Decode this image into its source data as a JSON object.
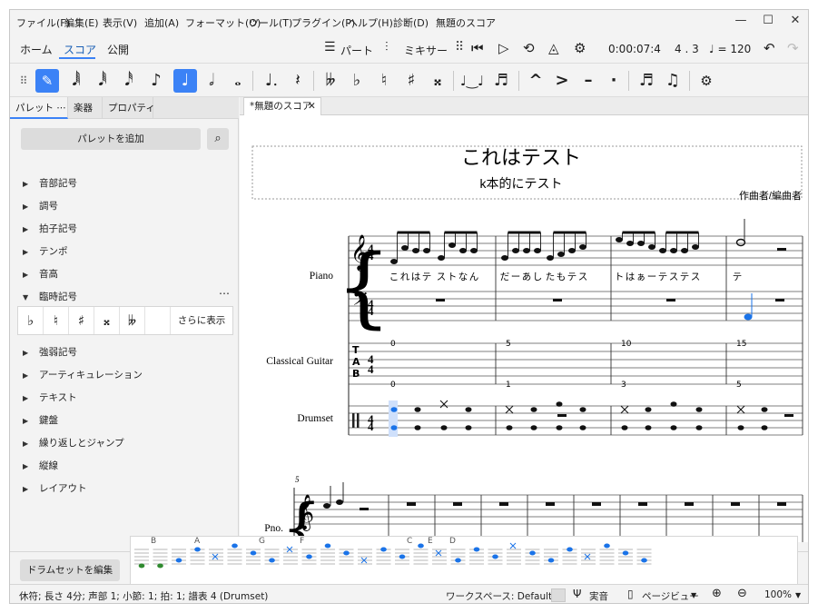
{
  "menu": {
    "items": [
      "ファイル(F)",
      "編集(E)",
      "表示(V)",
      "追加(A)",
      "フォーマット(O)",
      "ツール(T)",
      "プラグイン(P)",
      "ヘルプ(H)",
      "診断(D)",
      "無題のスコア"
    ]
  },
  "modes": {
    "home": "ホーム",
    "score": "スコア",
    "publish": "公開"
  },
  "toolbar": {
    "parts": "パート",
    "mixer": "ミキサー",
    "time": "0:00:07:4",
    "position": "4 . 3",
    "tempo": "♩ = 120"
  },
  "note_input": {
    "glyphs": [
      "✎",
      "𝅘𝅥𝅲",
      "𝅘𝅥𝅱",
      "𝅘𝅥𝅰",
      "♪",
      "♩",
      "𝅗𝅥",
      "𝅝",
      "♩.",
      "𝄽",
      "𝄫",
      "♭",
      "♮",
      "♯",
      "𝄪",
      "♩‿♩",
      "♬",
      "^",
      ">",
      "–",
      "·",
      "♬",
      "♫",
      "⚙"
    ]
  },
  "palette_tabs": [
    "パレット",
    "楽器",
    "プロパティ"
  ],
  "palette": {
    "add_button": "パレットを追加",
    "items": [
      "音部記号",
      "調号",
      "拍子記号",
      "テンポ",
      "音高",
      "臨時記号",
      "強弱記号",
      "アーティキュレーション",
      "テキスト",
      "鍵盤",
      "繰り返しとジャンプ",
      "縦線",
      "レイアウト"
    ],
    "accidentals": [
      "♭",
      "♮",
      "♯",
      "𝄪",
      "𝄫"
    ],
    "show_more": "さらに表示"
  },
  "document": {
    "tab_label": "*無題のスコア",
    "title": "これはテスト",
    "subtitle": "k本的にテスト",
    "composer": "作曲者/編曲者"
  },
  "score": {
    "instruments": [
      "Piano",
      "Classical Guitar",
      "Drumset"
    ],
    "lyrics": [
      "こ",
      "れ",
      "は",
      "テ",
      "ス",
      "ト",
      "な",
      "ん",
      "だ",
      "ー",
      "あ",
      "し",
      "た",
      "も",
      "テ",
      "ス",
      "ト",
      "は",
      "ぁ",
      "ー",
      "テ",
      "ス",
      "テ",
      "ス",
      "テ"
    ],
    "tab_numbers_top": [
      "0",
      "5",
      "10",
      "15"
    ],
    "tab_numbers_bottom": [
      "0",
      "1",
      "3",
      "5"
    ],
    "system2_measure": "5",
    "system2_instrument": "Pno."
  },
  "drumset": {
    "edit_button": "ドラムセットを編集",
    "labels": [
      "B",
      "A",
      "G",
      "F",
      "C",
      "E",
      "D"
    ]
  },
  "status": {
    "selection": "休符; 長さ 4分; 声部 1; 小節: 1; 拍: 1; 譜表 4 (Drumset)",
    "workspace": "ワークスペース: Default",
    "concert_pitch": "実音",
    "view": "ページビュー",
    "zoom": "100%"
  },
  "colors": {
    "accent": "#3b82f6",
    "selection": "#1a73e8"
  }
}
